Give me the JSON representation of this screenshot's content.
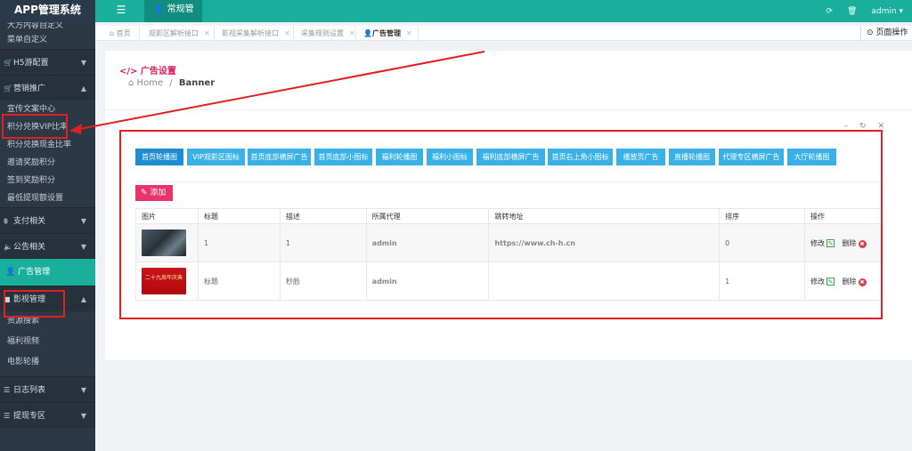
{
  "app": {
    "title": "APP管理系统",
    "menu_icon": "hamburger-icon"
  },
  "topbar": {
    "active_tab": "常规管理",
    "user": "admin",
    "refresh_icon": "refresh-icon",
    "trash_icon": "trash-icon"
  },
  "sidebar": {
    "partial_item": "大方内容自定义",
    "items_top": [
      "菜单自定义"
    ],
    "group_h5": "H5游配置",
    "group_marketing": "营销推广",
    "marketing_items": [
      "宣传文案中心",
      "积分兑换VIP比率",
      "积分兑换现金比率",
      "邀请奖励积分",
      "签到奖励积分",
      "最低提现额设置"
    ],
    "group_pay": "支付相关",
    "group_notice": "公告相关",
    "active_item": "广告管理",
    "group_video": "影视管理",
    "video_items": [
      "资源搜索",
      "福利视频",
      "电影轮播"
    ],
    "group_log": "日志列表",
    "group_withdraw": "提现专区"
  },
  "tabs": [
    {
      "label": "首页",
      "closable": false
    },
    {
      "label": "观影区解析接口",
      "closable": true
    },
    {
      "label": "影视采集解析接口",
      "closable": true
    },
    {
      "label": "采集规则设置",
      "closable": true
    },
    {
      "label": "广告管理",
      "closable": true,
      "active": true
    }
  ],
  "page_ops": "页面操作",
  "page": {
    "heading": "广告设置",
    "breadcrumb_home": "Home",
    "breadcrumb_sep": "/",
    "breadcrumb_current": "Banner",
    "window_controls": "– ↻ ✕"
  },
  "categories": [
    "首页轮播图",
    "VIP观影区图标",
    "首页底部横屏广告",
    "首页底部小图标",
    "福利轮播图",
    "福利小图标",
    "福利底部横屏广告",
    "首页右上角小图标",
    "播放页广告",
    "直播轮播图",
    "代理专区横屏广告",
    "大厅轮播图"
  ],
  "add_label": "添加",
  "table": {
    "headers": [
      "图片",
      "标题",
      "描述",
      "所属代理",
      "跳转地址",
      "排序",
      "操作"
    ],
    "rows": [
      {
        "image": "movie-still",
        "title": "1",
        "desc": "1",
        "agent": "admin",
        "url": "https://www.ch-h.cn",
        "sort": "0",
        "edit": "修改",
        "delete": "删除"
      },
      {
        "image": "red-banner",
        "image_text": "二十九周年庆典",
        "title": "标题",
        "desc": "秒脸",
        "agent": "admin",
        "url": "",
        "sort": "1",
        "edit": "修改",
        "delete": "删除"
      }
    ]
  },
  "colors": {
    "accent": "#1aaf9a",
    "sidebar": "#2d3845",
    "category_button": "#39b0e6",
    "add_button": "#e8336c",
    "annotation": "#e02020"
  }
}
